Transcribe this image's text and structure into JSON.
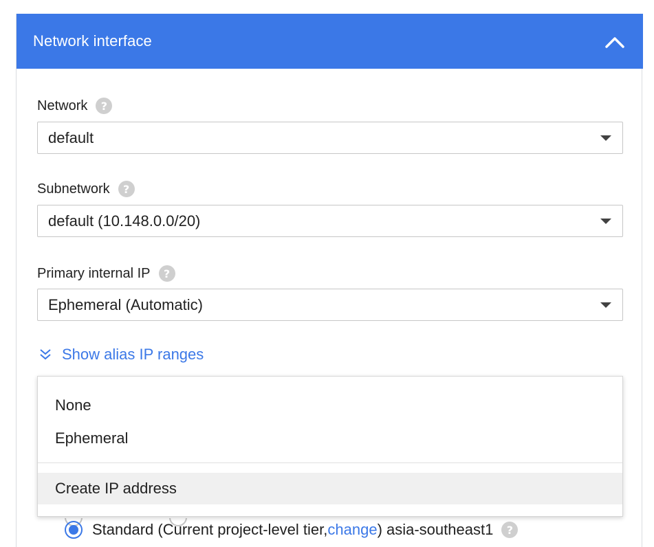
{
  "header": {
    "title": "Network interface"
  },
  "network": {
    "label": "Network",
    "value": "default"
  },
  "subnetwork": {
    "label": "Subnetwork",
    "value": "default (10.148.0.0/20)"
  },
  "primary_ip": {
    "label": "Primary internal IP",
    "value": "Ephemeral (Automatic)"
  },
  "alias": {
    "label": "Show alias IP ranges"
  },
  "menu": {
    "items": [
      {
        "label": "None"
      },
      {
        "label": "Ephemeral"
      },
      {
        "label": "Create IP address"
      }
    ]
  },
  "network_tier": {
    "prefix": "Standard (Current project-level tier, ",
    "link": "change",
    "suffix": ") asia-southeast1"
  },
  "colors": {
    "accent": "#3b78e7",
    "help_icon": "#cfcfcf"
  },
  "icons": {
    "collapse": "chevron-up-icon",
    "help": "help-icon",
    "expand": "double-chevron-down-icon"
  }
}
